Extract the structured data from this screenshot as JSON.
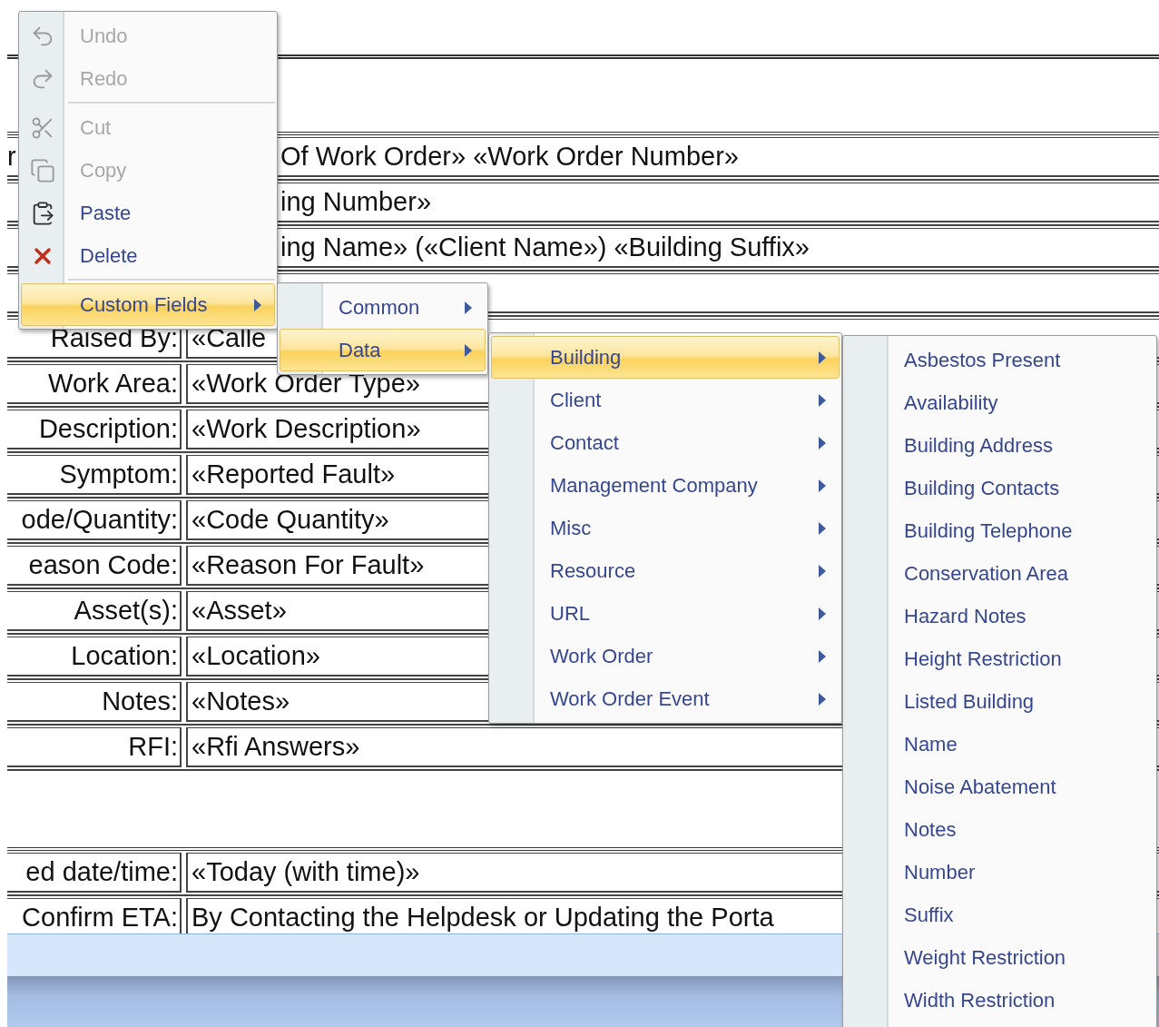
{
  "document": {
    "rows": [
      {
        "label": "r",
        "value": "Of Work Order» «Work Order Number»"
      },
      {
        "value": "ing Number»"
      },
      {
        "value": "ing Name» («Client Name») «Building Suffix»"
      },
      {},
      {
        "label": "Raised By:",
        "value": "«Calle"
      },
      {
        "label": "Work Area:",
        "value": "«Work Order Type»"
      },
      {
        "label": "Description:",
        "value": "«Work Description»"
      },
      {
        "label": "Symptom:",
        "value": "«Reported Fault»"
      },
      {
        "label": "ode/Quantity:",
        "value": "«Code Quantity»"
      },
      {
        "label": "eason Code:",
        "value": "«Reason For Fault»"
      },
      {
        "label": "Asset(s):",
        "value": "«Asset»"
      },
      {
        "label": "Location:",
        "value": "«Location»"
      },
      {
        "label": "Notes:",
        "value": "«Notes»"
      },
      {
        "label": "RFI:",
        "value": "«Rfi Answers»"
      },
      {
        "kind": "blank"
      },
      {
        "label": "ed date/time:",
        "value": "«Today (with time)»"
      },
      {
        "label": "Confirm ETA:",
        "value": "By Contacting the Helpdesk or Updating the Porta"
      }
    ]
  },
  "context_menu": {
    "items": [
      {
        "kind": "item",
        "label": "Undo",
        "disabled": true,
        "selected": false,
        "has_submenu": false
      },
      {
        "kind": "item",
        "label": "Redo",
        "disabled": true,
        "selected": false,
        "has_submenu": false
      },
      {
        "kind": "separator"
      },
      {
        "kind": "item",
        "label": "Cut",
        "disabled": true,
        "selected": false,
        "has_submenu": false
      },
      {
        "kind": "item",
        "label": "Copy",
        "disabled": true,
        "selected": false,
        "has_submenu": false
      },
      {
        "kind": "item",
        "label": "Paste",
        "disabled": false,
        "selected": false,
        "has_submenu": false
      },
      {
        "kind": "item",
        "label": "Delete",
        "disabled": false,
        "selected": false,
        "has_submenu": false
      },
      {
        "kind": "separator"
      },
      {
        "kind": "item",
        "label": "Custom Fields",
        "disabled": false,
        "selected": true,
        "has_submenu": true,
        "submenu": {
          "items": [
            {
              "kind": "item",
              "label": "Common",
              "disabled": false,
              "selected": false,
              "has_submenu": true
            },
            {
              "kind": "item",
              "label": "Data",
              "disabled": false,
              "selected": true,
              "has_submenu": true,
              "submenu": {
                "items": [
                  {
                    "kind": "item",
                    "label": "Building",
                    "disabled": false,
                    "selected": true,
                    "has_submenu": true,
                    "submenu": {
                      "items": [
                        {
                          "kind": "item",
                          "label": "Asbestos Present",
                          "disabled": false,
                          "selected": false,
                          "has_submenu": false
                        },
                        {
                          "kind": "item",
                          "label": "Availability",
                          "disabled": false,
                          "selected": false,
                          "has_submenu": false
                        },
                        {
                          "kind": "item",
                          "label": "Building Address",
                          "disabled": false,
                          "selected": false,
                          "has_submenu": false
                        },
                        {
                          "kind": "item",
                          "label": "Building Contacts",
                          "disabled": false,
                          "selected": false,
                          "has_submenu": false
                        },
                        {
                          "kind": "item",
                          "label": "Building Telephone",
                          "disabled": false,
                          "selected": false,
                          "has_submenu": false
                        },
                        {
                          "kind": "item",
                          "label": "Conservation Area",
                          "disabled": false,
                          "selected": false,
                          "has_submenu": false
                        },
                        {
                          "kind": "item",
                          "label": "Hazard Notes",
                          "disabled": false,
                          "selected": false,
                          "has_submenu": false
                        },
                        {
                          "kind": "item",
                          "label": "Height Restriction",
                          "disabled": false,
                          "selected": false,
                          "has_submenu": false
                        },
                        {
                          "kind": "item",
                          "label": "Listed Building",
                          "disabled": false,
                          "selected": false,
                          "has_submenu": false
                        },
                        {
                          "kind": "item",
                          "label": "Name",
                          "disabled": false,
                          "selected": false,
                          "has_submenu": false
                        },
                        {
                          "kind": "item",
                          "label": "Noise Abatement",
                          "disabled": false,
                          "selected": false,
                          "has_submenu": false
                        },
                        {
                          "kind": "item",
                          "label": "Notes",
                          "disabled": false,
                          "selected": false,
                          "has_submenu": false
                        },
                        {
                          "kind": "item",
                          "label": "Number",
                          "disabled": false,
                          "selected": false,
                          "has_submenu": false
                        },
                        {
                          "kind": "item",
                          "label": "Suffix",
                          "disabled": false,
                          "selected": false,
                          "has_submenu": false
                        },
                        {
                          "kind": "item",
                          "label": "Weight Restriction",
                          "disabled": false,
                          "selected": false,
                          "has_submenu": false
                        },
                        {
                          "kind": "item",
                          "label": "Width Restriction",
                          "disabled": false,
                          "selected": false,
                          "has_submenu": false
                        }
                      ]
                    }
                  },
                  {
                    "kind": "item",
                    "label": "Client",
                    "disabled": false,
                    "selected": false,
                    "has_submenu": true
                  },
                  {
                    "kind": "item",
                    "label": "Contact",
                    "disabled": false,
                    "selected": false,
                    "has_submenu": true
                  },
                  {
                    "kind": "item",
                    "label": "Management Company",
                    "disabled": false,
                    "selected": false,
                    "has_submenu": true
                  },
                  {
                    "kind": "item",
                    "label": "Misc",
                    "disabled": false,
                    "selected": false,
                    "has_submenu": true
                  },
                  {
                    "kind": "item",
                    "label": "Resource",
                    "disabled": false,
                    "selected": false,
                    "has_submenu": true
                  },
                  {
                    "kind": "item",
                    "label": "URL",
                    "disabled": false,
                    "selected": false,
                    "has_submenu": true
                  },
                  {
                    "kind": "item",
                    "label": "Work Order",
                    "disabled": false,
                    "selected": false,
                    "has_submenu": true
                  },
                  {
                    "kind": "item",
                    "label": "Work Order Event",
                    "disabled": false,
                    "selected": false,
                    "has_submenu": true
                  }
                ]
              }
            }
          ]
        }
      }
    ]
  }
}
